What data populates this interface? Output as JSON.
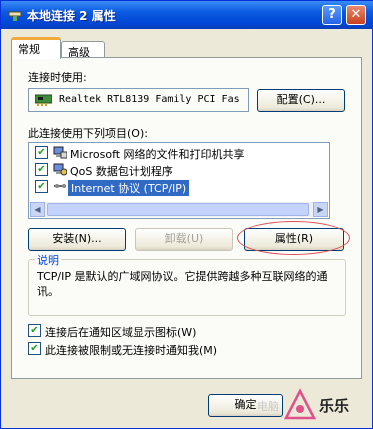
{
  "window": {
    "title": "本地连接 2 属性",
    "help_label": "?",
    "close_label": "✕"
  },
  "tabs": [
    {
      "label": "常规",
      "active": true
    },
    {
      "label": "高级",
      "active": false
    }
  ],
  "connect_using": {
    "label": "连接时使用:",
    "adapter": "Realtek RTL8139 Family PCI Fas",
    "configure_button": "配置(C)..."
  },
  "components": {
    "label": "此连接使用下列项目(O):",
    "items": [
      {
        "checked": true,
        "label": "Microsoft 网络的文件和打印机共享",
        "icon": "network-sharing-icon",
        "selected": false
      },
      {
        "checked": true,
        "label": "QoS 数据包计划程序",
        "icon": "qos-icon",
        "selected": false
      },
      {
        "checked": true,
        "label": "Internet 协议 (TCP/IP)",
        "icon": "protocol-icon",
        "selected": true
      }
    ]
  },
  "buttons": {
    "install": "安装(N)...",
    "uninstall": "卸载(U)",
    "properties": "属性(R)"
  },
  "description": {
    "title": "说明",
    "text": "TCP/IP 是默认的广域网协议。它提供跨越多种互联网络的通讯。"
  },
  "options": [
    {
      "checked": true,
      "label": "连接后在通知区域显示图标(W)"
    },
    {
      "checked": true,
      "label": "此连接被限制或无连接时通知我(M)"
    }
  ],
  "footer": {
    "ok_button": "确定"
  },
  "watermark": {
    "text1": "电脑",
    "text2": "乐乐"
  },
  "colors": {
    "titlebar": "#0a5ae0",
    "selection": "#316ac5",
    "tab_highlight": "#f0a93a",
    "annotation_circle": "#e05050"
  }
}
